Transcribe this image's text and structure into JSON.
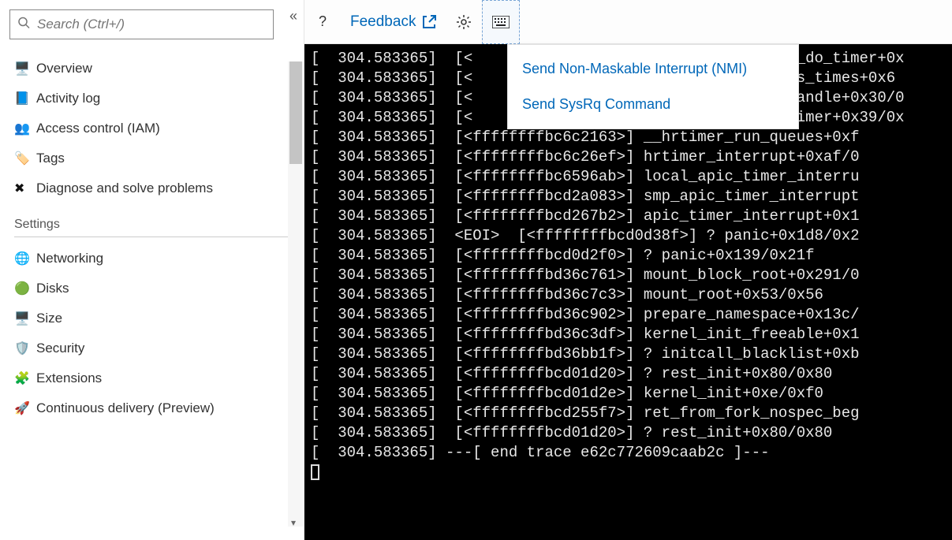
{
  "sidebar": {
    "search_placeholder": "Search (Ctrl+/)",
    "top_items": [
      {
        "icon": "🖥️",
        "label": "Overview",
        "color": "#2f87c4"
      },
      {
        "icon": "📘",
        "label": "Activity log",
        "color": "#1d6fbf"
      },
      {
        "icon": "👥",
        "label": "Access control (IAM)",
        "color": "#2f87c4"
      },
      {
        "icon": "🏷️",
        "label": "Tags",
        "color": "#6b3fa0"
      },
      {
        "icon": "✖",
        "label": "Diagnose and solve problems",
        "color": "#111"
      }
    ],
    "section_label": "Settings",
    "settings_items": [
      {
        "icon": "🌐",
        "label": "Networking",
        "color": "#2f87c4"
      },
      {
        "icon": "🟢",
        "label": "Disks",
        "color": "#2e8b57"
      },
      {
        "icon": "🖥️",
        "label": "Size",
        "color": "#2f87c4"
      },
      {
        "icon": "🛡️",
        "label": "Security",
        "color": "#7bbf3a"
      },
      {
        "icon": "🧩",
        "label": "Extensions",
        "color": "#2f87c4"
      },
      {
        "icon": "🚀",
        "label": "Continuous delivery (Preview)",
        "color": "#2f87c4"
      }
    ]
  },
  "toolbar": {
    "feedback_label": "Feedback"
  },
  "dropdown": {
    "items": [
      "Send Non-Maskable Interrupt (NMI)",
      "Send SysRq Command"
    ]
  },
  "console": {
    "lines": [
      "[  304.583365]  [<                                 hed_do_timer+0x",
      "[  304.583365]  [<                                 cess_times+0x6",
      "[  304.583365]  [<                                 d_handle+0x30/0",
      "[  304.583365]  [<                                 d_timer+0x39/0x",
      "[  304.583365]  [<ffffffffbc6c2163>] __hrtimer_run_queues+0xf",
      "[  304.583365]  [<ffffffffbc6c26ef>] hrtimer_interrupt+0xaf/0",
      "[  304.583365]  [<ffffffffbc6596ab>] local_apic_timer_interru",
      "[  304.583365]  [<ffffffffbcd2a083>] smp_apic_timer_interrupt",
      "[  304.583365]  [<ffffffffbcd267b2>] apic_timer_interrupt+0x1",
      "[  304.583365]  <EOI>  [<ffffffffbcd0d38f>] ? panic+0x1d8/0x2",
      "[  304.583365]  [<ffffffffbcd0d2f0>] ? panic+0x139/0x21f",
      "[  304.583365]  [<ffffffffbd36c761>] mount_block_root+0x291/0",
      "[  304.583365]  [<ffffffffbd36c7c3>] mount_root+0x53/0x56",
      "[  304.583365]  [<ffffffffbd36c902>] prepare_namespace+0x13c/",
      "[  304.583365]  [<ffffffffbd36c3df>] kernel_init_freeable+0x1",
      "[  304.583365]  [<ffffffffbd36bb1f>] ? initcall_blacklist+0xb",
      "[  304.583365]  [<ffffffffbcd01d20>] ? rest_init+0x80/0x80",
      "[  304.583365]  [<ffffffffbcd01d2e>] kernel_init+0xe/0xf0",
      "[  304.583365]  [<ffffffffbcd255f7>] ret_from_fork_nospec_beg",
      "[  304.583365]  [<ffffffffbcd01d20>] ? rest_init+0x80/0x80",
      "[  304.583365] ---[ end trace e62c772609caab2c ]---"
    ]
  }
}
